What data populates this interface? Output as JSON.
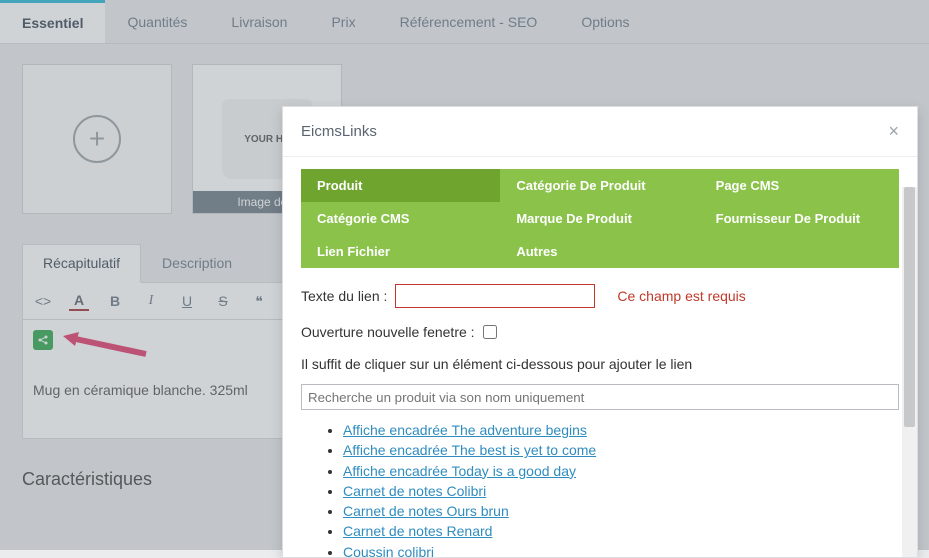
{
  "tabs": {
    "essentiel": "Essentiel",
    "quantites": "Quantités",
    "livraison": "Livraison",
    "prix": "Prix",
    "seo": "Référencement - SEO",
    "options": "Options"
  },
  "images": {
    "cover_label": "Image de c",
    "placeholder_text": "YOUR\nHE"
  },
  "sub_tabs": {
    "recap": "Récapitulatif",
    "description": "Description"
  },
  "editor": {
    "content_text": "Mug en céramique blanche. 325ml"
  },
  "section": {
    "characteristics": "Caractéristiques"
  },
  "modal": {
    "title": "EicmsLinks",
    "green_tabs": {
      "produit": "Produit",
      "categorie_cms": "Catégorie CMS",
      "lien_fichier": "Lien Fichier",
      "categorie_produit": "Catégorie De Produit",
      "marque_produit": "Marque De Produit",
      "autres": "Autres",
      "page_cms": "Page CMS",
      "fournisseur_produit": "Fournisseur De Produit"
    },
    "link_text_label": "Texte du lien :",
    "link_text_error": "Ce champ est requis",
    "new_window_label": "Ouverture nouvelle fenetre :",
    "instruction": "Il suffit de cliquer sur un élément ci-dessous pour ajouter le lien",
    "search_placeholder": "Recherche un produit via son nom uniquement",
    "products": [
      "Affiche encadrée The adventure begins",
      "Affiche encadrée The best is yet to come",
      "Affiche encadrée Today is a good day",
      "Carnet de notes Colibri",
      "Carnet de notes Ours brun",
      "Carnet de notes Renard",
      "Coussin colibri"
    ]
  }
}
